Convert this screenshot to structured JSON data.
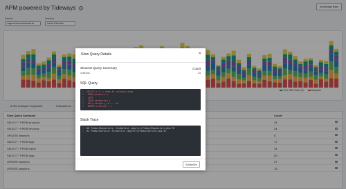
{
  "app": {
    "title": "APM powered by Tideways",
    "knowledge_base_button": "Knowledge Base"
  },
  "filters": {
    "domain_label": "Domain",
    "domain_value": "magento-test.massiveart.de",
    "period_label": "Zeitraum",
    "period_value": "Letzte 6 Stunden"
  },
  "chart": {
    "legend": [
      {
        "label": "Perf. 95th Time (%)",
        "color": "#2a8f6a"
      },
      {
        "label": "Requests",
        "color": "#e05c4a"
      }
    ],
    "colors": [
      "#d9534f",
      "#f0ad4e",
      "#5cb85c",
      "#2c7fb8",
      "#7b5ea7",
      "#1a9c8a",
      "#e6d24a"
    ]
  },
  "stats": {
    "requests": "6.961 Anfragen insgesamt",
    "transactions": "Transactions"
  },
  "table": {
    "headers": [
      "Slow Query Summary",
      "Count"
    ],
    "rows": [
      {
        "query": "SELECT * FROM products",
        "time": "",
        "count": "24"
      },
      {
        "query": "SELECT * FROM invoices",
        "time": "",
        "count": "24"
      },
      {
        "query": "UPDATE sessions",
        "time": "",
        "count": "8"
      },
      {
        "query": "SELECT * FROM logs",
        "time": "",
        "count": "17"
      },
      {
        "query": "SELECT * FROM users",
        "time": "",
        "count": "34"
      },
      {
        "query": "SELECT * FROM logs",
        "time": "",
        "count": "50"
      },
      {
        "query": "UPDATE sessions",
        "time": "4.498ms",
        "count": "27"
      },
      {
        "query": "UPDATE sessions",
        "time": "4.147ms",
        "count": "13"
      }
    ]
  },
  "modal": {
    "title": "Slow Query Details",
    "close_icon": "close-icon",
    "summary_label": "Slowest Query Summary",
    "summary_value": "4.981ms",
    "count_label": "Count",
    "count_value": "24",
    "sql_heading": "SQL Query",
    "sql_lines": [
      "SELECT p.*, c.name AS category_name",
      "  FROM products p",
      "  LEFT",
      "  JOIN categories c",
      "  ON p.category_id = c.id",
      "  WHERE p.active = 1"
    ],
    "stack_heading": "Stack Trace",
    "stack_lines": [
      "#0 ProductRepository::findActive /app/src/ProductRepository.php:78",
      "#1 ProductService::listActive /app/src/ProductService.php:19"
    ],
    "close_button": "Schließen"
  }
}
